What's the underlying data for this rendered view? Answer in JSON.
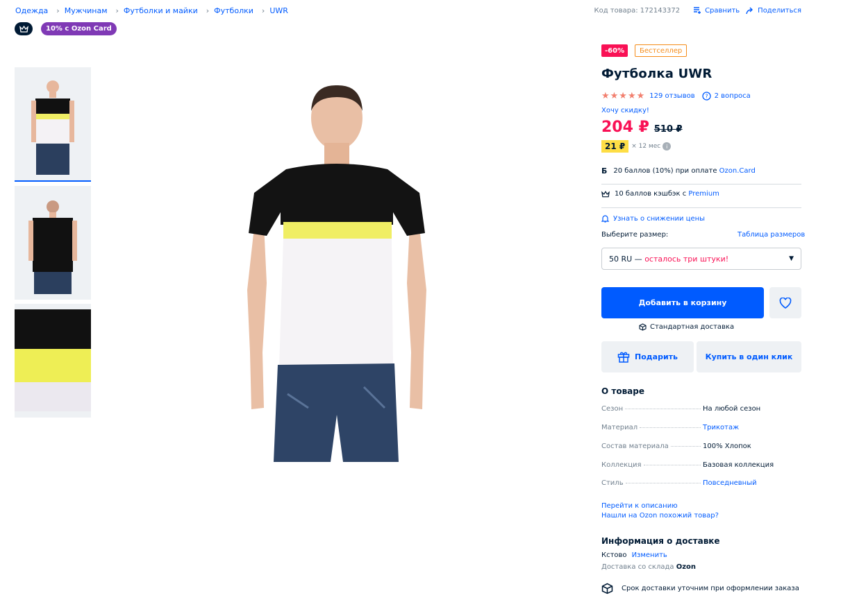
{
  "breadcrumbs": [
    "Одежда",
    "Мужчинам",
    "Футболки и майки",
    "Футболки",
    "UWR"
  ],
  "top_actions": {
    "product_code": "Код товара: 172143372",
    "compare": "Сравнить",
    "share": "Поделиться"
  },
  "badges": {
    "ozon_card": "10% с Ozon Card",
    "discount": "-60%",
    "bestseller": "Бестселлер"
  },
  "product": {
    "title": "Футболка UWR",
    "rating": 4.5,
    "reviews": "129 отзывов",
    "questions": "2 вопроса",
    "want_discount": "Хочу скидку!",
    "price_now": "204 ₽",
    "price_old": "510 ₽",
    "installment_amount": "21 ₽",
    "installment_term": "× 12 мес"
  },
  "bonuses": {
    "card_text": "20 баллов (10%) при оплате ",
    "card_link": "Ozon.Card",
    "premium_text": "10 баллов кэшбэк с ",
    "premium_link": "Premium",
    "price_alert": "Узнать о снижении цены"
  },
  "size": {
    "label": "Выберите размер:",
    "table_link": "Таблица размеров",
    "selected": "50 RU — ",
    "selected_warning": "осталось три штуки!"
  },
  "actions": {
    "add_to_cart": "Добавить в корзину",
    "standard_delivery": "Стандартная доставка",
    "gift": "Подарить",
    "buy_one_click": "Купить в один клик"
  },
  "about": {
    "title": "О товаре",
    "attributes": [
      {
        "key": "Сезон",
        "value": "На любой сезон",
        "link": false
      },
      {
        "key": "Материал",
        "value": "Трикотаж",
        "link": true
      },
      {
        "key": "Состав материала",
        "value": "100% Хлопок",
        "link": false
      },
      {
        "key": "Коллекция",
        "value": "Базовая коллекция",
        "link": false
      },
      {
        "key": "Стиль",
        "value": "Повседневный",
        "link": true
      }
    ],
    "to_description": "Перейти к описанию",
    "found_cheaper": "Нашли на Ozon похожий товар?"
  },
  "delivery_info": {
    "title": "Информация о доставке",
    "city": "Кстово",
    "change": "Изменить",
    "warehouse_text": "Доставка со склада ",
    "warehouse_name": "Ozon",
    "note": "Срок доставки уточним при оформлении заказа"
  },
  "colors": {
    "accent": "#005bff",
    "price": "#f91155",
    "ozon_card_purple": "#7f39b5",
    "installment_yellow": "#fede45"
  }
}
